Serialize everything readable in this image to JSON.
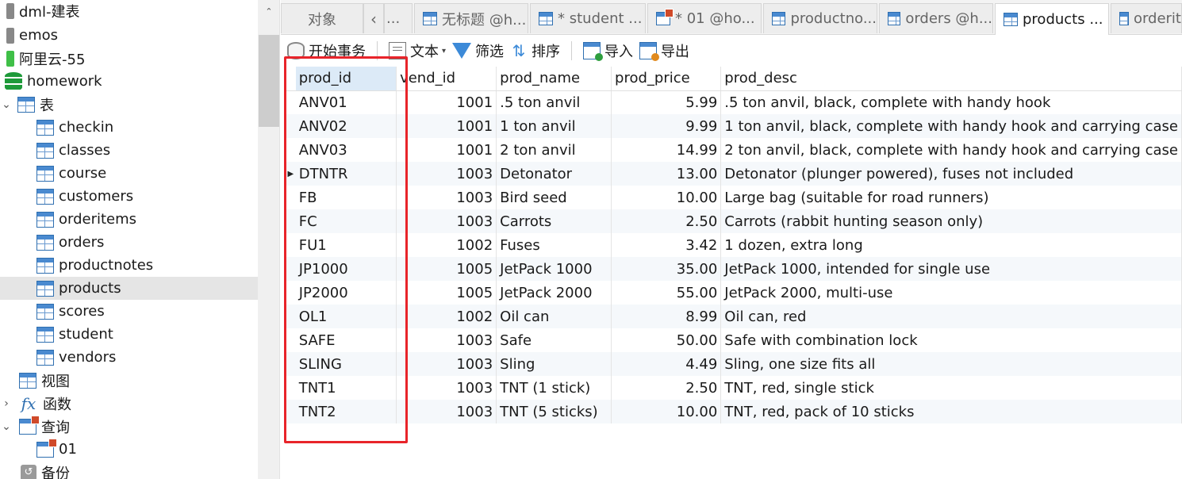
{
  "sidebar": {
    "items": [
      {
        "label": "dml-建表",
        "icon": "connection-icon"
      },
      {
        "label": "emos",
        "icon": "connection-icon"
      },
      {
        "label": "阿里云-55",
        "icon": "connection-icon-green"
      },
      {
        "label": "homework",
        "icon": "database-icon"
      },
      {
        "label": "表",
        "icon": "tables-folder-icon",
        "expanded": true
      },
      {
        "label": "checkin",
        "icon": "table-icon"
      },
      {
        "label": "classes",
        "icon": "table-icon"
      },
      {
        "label": "course",
        "icon": "table-icon"
      },
      {
        "label": "customers",
        "icon": "table-icon"
      },
      {
        "label": "orderitems",
        "icon": "table-icon"
      },
      {
        "label": "orders",
        "icon": "table-icon"
      },
      {
        "label": "productnotes",
        "icon": "table-icon"
      },
      {
        "label": "products",
        "icon": "table-icon",
        "selected": true
      },
      {
        "label": "scores",
        "icon": "table-icon"
      },
      {
        "label": "student",
        "icon": "table-icon"
      },
      {
        "label": "vendors",
        "icon": "table-icon"
      },
      {
        "label": "视图",
        "icon": "view-icon"
      },
      {
        "label": "函数",
        "icon": "function-icon",
        "expanded": false
      },
      {
        "label": "查询",
        "icon": "query-icon",
        "expanded": true
      },
      {
        "label": "01",
        "icon": "query-icon"
      },
      {
        "label": "备份",
        "icon": "backup-icon"
      }
    ]
  },
  "tabs": [
    {
      "label": "对象"
    },
    {
      "label": "..."
    },
    {
      "label": "无标题 @h..."
    },
    {
      "label": "* student ..."
    },
    {
      "label": "* 01 @ho..."
    },
    {
      "label": "productno..."
    },
    {
      "label": "orders @h..."
    },
    {
      "label": "products ...",
      "active": true
    },
    {
      "label": "orderit"
    }
  ],
  "toolbar": {
    "begin_transaction": "开始事务",
    "text": "文本",
    "filter": "筛选",
    "sort": "排序",
    "import": "导入",
    "export": "导出"
  },
  "grid": {
    "columns": [
      "prod_id",
      "vend_id",
      "prod_name",
      "prod_price",
      "prod_desc"
    ],
    "rows": [
      [
        "ANV01",
        "1001",
        ".5 ton anvil",
        "5.99",
        ".5 ton anvil, black, complete with handy hook"
      ],
      [
        "ANV02",
        "1001",
        "1 ton anvil",
        "9.99",
        "1 ton anvil, black, complete with handy hook and carrying case"
      ],
      [
        "ANV03",
        "1001",
        "2 ton anvil",
        "14.99",
        "2 ton anvil, black, complete with handy hook and carrying case"
      ],
      [
        "DTNTR",
        "1003",
        "Detonator",
        "13.00",
        "Detonator (plunger powered), fuses not included"
      ],
      [
        "FB",
        "1003",
        "Bird seed",
        "10.00",
        "Large bag (suitable for road runners)"
      ],
      [
        "FC",
        "1003",
        "Carrots",
        "2.50",
        "Carrots (rabbit hunting season only)"
      ],
      [
        "FU1",
        "1002",
        "Fuses",
        "3.42",
        "1 dozen, extra long"
      ],
      [
        "JP1000",
        "1005",
        "JetPack 1000",
        "35.00",
        "JetPack 1000, intended for single use"
      ],
      [
        "JP2000",
        "1005",
        "JetPack 2000",
        "55.00",
        "JetPack 2000, multi-use"
      ],
      [
        "OL1",
        "1002",
        "Oil can",
        "8.99",
        "Oil can, red"
      ],
      [
        "SAFE",
        "1003",
        "Safe",
        "50.00",
        "Safe with combination lock"
      ],
      [
        "SLING",
        "1003",
        "Sling",
        "4.49",
        "Sling, one size fits all"
      ],
      [
        "TNT1",
        "1003",
        "TNT (1 stick)",
        "2.50",
        "TNT, red, single stick"
      ],
      [
        "TNT2",
        "1003",
        "TNT (5 sticks)",
        "10.00",
        "TNT, red, pack of 10 sticks"
      ]
    ]
  },
  "colors": {
    "highlight": "#e8242a",
    "selected_row": "#e5e5e5",
    "selected_header": "#dceaf7",
    "accent": "#2f6fb0"
  }
}
